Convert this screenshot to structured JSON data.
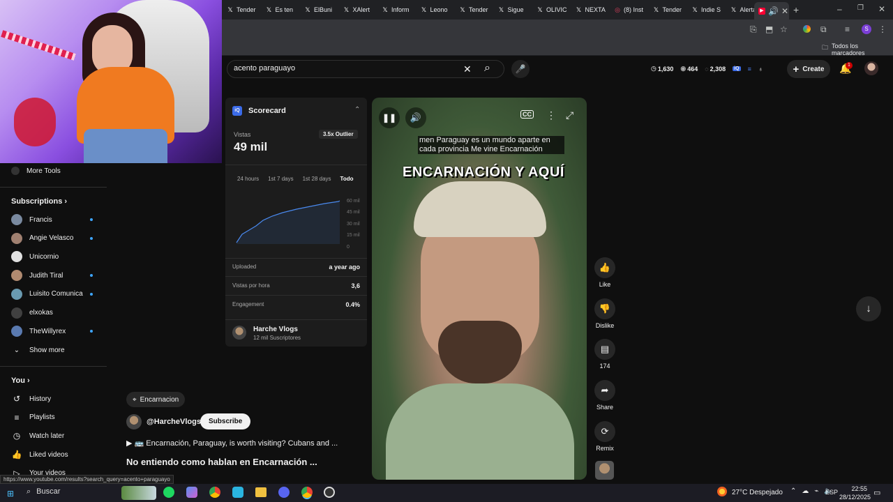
{
  "browser": {
    "tabs": [
      {
        "label": "Tender",
        "icon": "x-icon"
      },
      {
        "label": "Es ten",
        "icon": "x-icon"
      },
      {
        "label": "ElBuni",
        "icon": "x-icon"
      },
      {
        "label": "XAlert",
        "icon": "x-icon"
      },
      {
        "label": "Inform",
        "icon": "x-icon"
      },
      {
        "label": "Leono",
        "icon": "x-icon"
      },
      {
        "label": "Tender",
        "icon": "x-icon"
      },
      {
        "label": "Sigue",
        "icon": "x-icon"
      },
      {
        "label": "OLIVIC",
        "icon": "x-icon"
      },
      {
        "label": "NEXTA",
        "icon": "x-icon"
      },
      {
        "label": "(8) Inst",
        "icon": "instagram-icon"
      },
      {
        "label": "Tender",
        "icon": "x-icon"
      },
      {
        "label": "Indie S",
        "icon": "x-icon"
      },
      {
        "label": "Alerta",
        "icon": "x-icon"
      }
    ],
    "bookmarks_label": "Todos los marcadores",
    "status_url": "https://www.youtube.com/results?search_query=acento+paraguayo"
  },
  "youtube": {
    "search_query": "acento paraguayo",
    "stats": {
      "views_icon_value": "1,630",
      "eye_value": "464",
      "comment_value": "2,308"
    },
    "create_label": "Create",
    "notif_count": "1"
  },
  "sidebar": {
    "more_tools": "More Tools",
    "subscriptions_title": "Subscriptions",
    "subscriptions": [
      {
        "name": "Francis",
        "dot": true,
        "color": "#7a8aa0"
      },
      {
        "name": "Angie Velasco",
        "dot": true,
        "color": "#a08070"
      },
      {
        "name": "Unicornio",
        "dot": false,
        "color": "#e0e0e0"
      },
      {
        "name": "Judith Tiral",
        "dot": true,
        "color": "#b08a70"
      },
      {
        "name": "Luisito Comunica",
        "dot": true,
        "color": "#6a9ab0"
      },
      {
        "name": "elxokas",
        "dot": false,
        "color": "#404040"
      },
      {
        "name": "TheWillyrex",
        "dot": true,
        "color": "#5a7ab0"
      }
    ],
    "show_more": "Show more",
    "you_title": "You",
    "you_items": [
      "History",
      "Playlists",
      "Watch later",
      "Liked videos",
      "Your videos"
    ]
  },
  "scorecard": {
    "title": "Scorecard",
    "views_label": "Vistas",
    "views_value": "49 mil",
    "outlier": "3.5x Outlier",
    "periods": [
      "24 hours",
      "1st 7 days",
      "1st 28 days",
      "Todo"
    ],
    "active_period": "Todo",
    "chart_ticks": [
      "60 mil",
      "45 mil",
      "30 mil",
      "15 mil",
      "0"
    ],
    "rows": [
      {
        "label": "Uploaded",
        "value": "a year ago"
      },
      {
        "label": "Vistas por hora",
        "value": "3,6"
      },
      {
        "label": "Engagement",
        "value": "0.4%"
      }
    ],
    "channel_name": "Harche Vlogs",
    "channel_subs": "12 mil Suscriptores"
  },
  "video": {
    "caption": "men Paraguay es un mundo aparte en cada provincia Me vine Encarnación",
    "overlay_text": "ENCARNACIÓN Y AQUÍ",
    "location": "Encarnacion",
    "channel_handle": "@HarcheVlogs",
    "subscribe_label": "Subscribe",
    "related_link": "▶ 🚌 Encarnación, Paraguay, is worth visiting? Cubans and ...",
    "title": "No entiendo como hablan en Encarnación ..."
  },
  "actions": [
    {
      "label": "Like",
      "icon": "thumbs-up-icon"
    },
    {
      "label": "Dislike",
      "icon": "thumbs-down-icon"
    },
    {
      "label": "174",
      "icon": "comment-icon"
    },
    {
      "label": "Share",
      "icon": "share-icon"
    },
    {
      "label": "Remix",
      "icon": "remix-icon"
    }
  ],
  "taskbar": {
    "search_placeholder": "Buscar",
    "weather": "27°C  Despejado",
    "language": "ESP",
    "time": "22:55",
    "date": "28/12/2025"
  }
}
